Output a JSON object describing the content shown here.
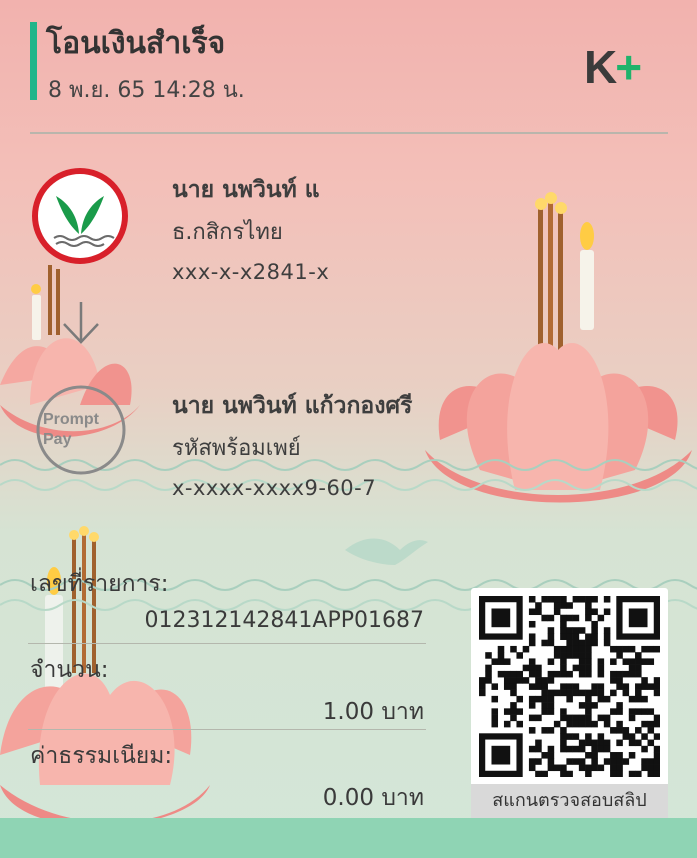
{
  "header": {
    "title": "โอนเงินสำเร็จ",
    "datetime": "8 พ.ย. 65  14:28 น.",
    "logo_k": "K",
    "logo_plus": "+"
  },
  "sender": {
    "name": "นาย นพวินท์ แ",
    "bank": "ธ.กสิกรไทย",
    "account": "xxx-x-x2841-x",
    "logo": "kbank-leaf-icon"
  },
  "receiver": {
    "name": "นาย นพวินท์ แก้วกองศรี",
    "channel": "รหัสพร้อมเพย์",
    "account": "x-xxxx-xxxx9-60-7",
    "logo_line1": "Prompt",
    "logo_line2": "Pay"
  },
  "details": {
    "ref_label": "เลขที่รายการ:",
    "ref_value": "012312142841APP01687",
    "amount_label": "จำนวน:",
    "amount_value": "1.00 บาท",
    "fee_label": "ค่าธรรมเนียม:",
    "fee_value": "0.00 บาท"
  },
  "qr": {
    "caption": "สแกนตรวจสอบสลิป"
  },
  "colors": {
    "accent": "#20b58a",
    "kbank_green": "#1a9b4a",
    "kbank_red": "#d8202a",
    "bottom_bar": "#8fd4b4"
  }
}
